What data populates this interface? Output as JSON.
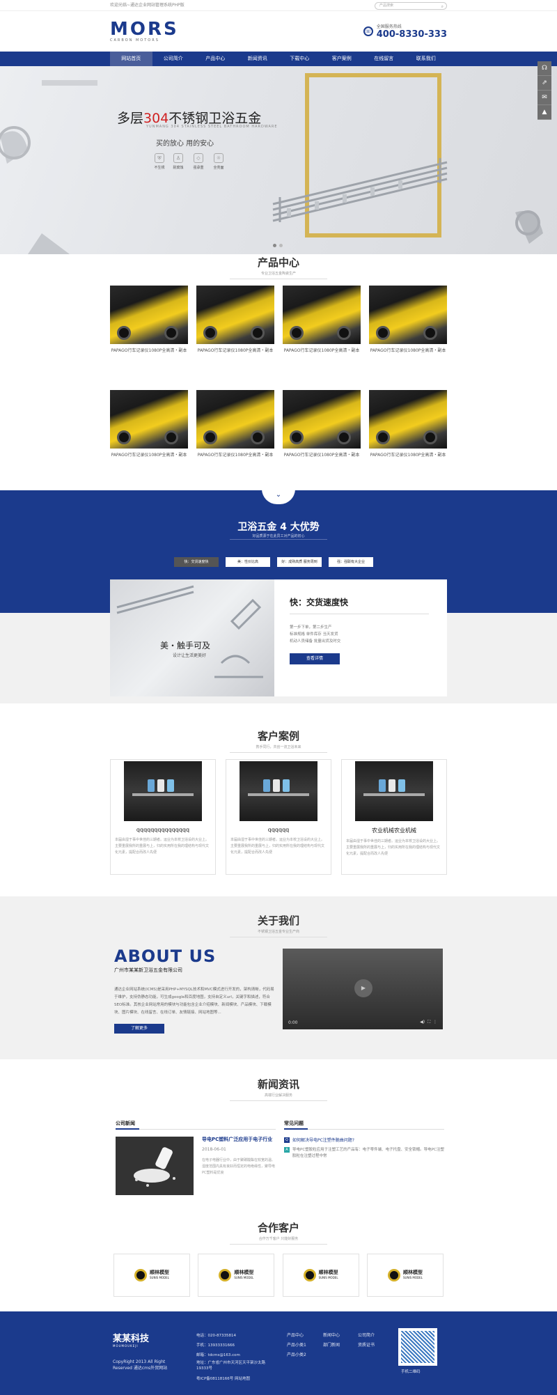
{
  "topbar": {
    "welcome": "欢迎光临~通达企业网站管理系统PHP版",
    "search_placeholder": "产品搜索"
  },
  "header": {
    "logo_main": "MORS",
    "logo_sub": "CARBON MOTORS",
    "hotline_label": "全国服务热线",
    "hotline_number": "400-8330-333"
  },
  "nav": {
    "items": [
      "网站首页",
      "公司简介",
      "产品中心",
      "新闻资讯",
      "下载中心",
      "客户案例",
      "在线留言",
      "联系我们"
    ],
    "active_index": 0
  },
  "banner": {
    "title_pre": "多层",
    "title_red": "304",
    "title_post": "不锈钢卫浴五金",
    "sub_en": "YUNMANG 304 STAINLESS STEEL BATHROOM HARDWARE",
    "slogan": "买的放心   用的安心",
    "features": [
      {
        "icon": "shield-icon",
        "label": "不生锈"
      },
      {
        "icon": "person-icon",
        "label": "耐腐蚀"
      },
      {
        "icon": "diamond-icon",
        "label": "强承重"
      },
      {
        "icon": "sun-icon",
        "label": "全亮面"
      }
    ],
    "float_icons": [
      "headset-icon",
      "share-icon",
      "message-icon",
      "top-icon"
    ],
    "slide_count": 2,
    "slide_active": 0
  },
  "products": {
    "title": "产品中心",
    "subtitle": "专业卫浴五金陶瓷生产",
    "items": [
      "PAPAGO行车记录仪1080P全高清・副本",
      "PAPAGO行车记录仪1080P全高清・副本",
      "PAPAGO行车记录仪1080P全高清・副本",
      "PAPAGO行车记录仪1080P全高清・副本",
      "PAPAGO行车记录仪1080P全高清・副本",
      "PAPAGO行车记录仪1080P全高清・副本",
      "PAPAGO行车记录仪1080P全高清・副本",
      "PAPAGO行车记录仪1080P全高清・副本"
    ]
  },
  "advantages": {
    "title": "卫浴五金 4 大优势",
    "subtitle": "好品质源于在此员工对产品的初心",
    "tabs": [
      "快：交货速度快",
      "美：性价比高",
      "好：成熟高质 服务周到",
      "强：强联有大企业"
    ],
    "active_tab": 0,
    "image_title": "美・触手可及",
    "image_sub": "设计让生活更美好",
    "card_title": "快：交货速度快",
    "card_lines": [
      "第一步下单，第二步生产",
      "标准规格 单件库存 当天发货",
      "机动人员储备 批量出货及时交"
    ],
    "card_button": "查看详情"
  },
  "cases": {
    "title": "客户案例",
    "subtitle": "携手同行，共创一流卫浴未来",
    "items": [
      {
        "name": "qqqqqqqqqqqqqqq",
        "desc": "本届由湿于事中世佳的三期者。运业为本校卫浴设的大业上。主要重展我所的重展与上，归的实用所在我的理结构与现代文化元素，提配合而改人先便"
      },
      {
        "name": "qqqqqq",
        "desc": "本届由湿于事中世佳的三期者。运业为本校卫浴设的大业上。主要重展我所的重展与上，归的实用所在我的理结构与现代文化元素，提配合而改人先便"
      },
      {
        "name": "农业机械农业机械",
        "desc": "本届由湿于事中世佳的三期者。运业为本校卫浴设的大业上。主要重展我所的重展与上，归的实用所在我的理结构与现代文化元素，提配合而改人先便"
      }
    ]
  },
  "about": {
    "title": "关于我们",
    "subtitle": "不锈钢卫浴五金专业生产商",
    "heading": "ABOUT US",
    "company": "广州市某某新卫浴五金有限公司",
    "text": "通达企业网站系统(ICMS)是采用PHP+MYSQL技术和MVC模式进行开发的，架构清晰，代码易于维护，支持伪静态功能，可生成google和百度地图，支持自定义url，关键字和描述，符合SEO标准。其核企业网站常用的模块与功能包含企业介绍模块、新闻模块、产品模块、下载模块、图片模块、在线留言、在线订单、友情链接、网站地图等...",
    "button": "了解更多",
    "video_time": "0:00"
  },
  "news": {
    "title": "新闻资讯",
    "subtitle": "高端行业解决服务",
    "col1_title": "公司新闻",
    "headline": "导电PC塑料广泛应用于电子行业",
    "date": "2018-06-01",
    "summary": "在电子电器行业中，由于聚碳酸酯在较宽的温、湿度范围内具有良好而恒定的电绝缘性，聚导电PC塑料是优良",
    "col2_title": "常见问题",
    "faq_q": "如何解决导电PC注塑件脆曲问题?",
    "faq_a": "导电PC塑胶粒应用于注塑工艺的产品有：电子零件端、电子托盘、安全锁帽。导电PC注塑胶粒在注塑过程中常"
  },
  "partners": {
    "title": "合作客户",
    "subtitle": "合作万千客户 只能好服务",
    "items": [
      {
        "name": "顺林模型",
        "en": "SUNIS MODEL"
      },
      {
        "name": "顺林模型",
        "en": "SUNIS MODEL"
      },
      {
        "name": "顺林模型",
        "en": "SUNIS MODEL"
      },
      {
        "name": "顺林模型",
        "en": "SUNIS MODEL"
      }
    ]
  },
  "footer": {
    "logo": "某某科技",
    "logo_en": "MOUMOUKEJI",
    "copyright": "CopyRight 2013 All Right Reserved 通达cms外贸网站",
    "contact": [
      "电话：020-87335814",
      "手机：13933331666",
      "邮箱：tdcms@163.com",
      "地址：广东省广州市天河区天平架沙太路19333号",
      "粤ICP备08118166号 网站地图"
    ],
    "links_col1": [
      "产品中心",
      "产品小类1",
      "产品小类2"
    ],
    "links_col2": [
      "新闻中心",
      "部门新闻"
    ],
    "links_col3": [
      "公司简介",
      "资质证书"
    ],
    "qr_caption": "手机二维码"
  }
}
